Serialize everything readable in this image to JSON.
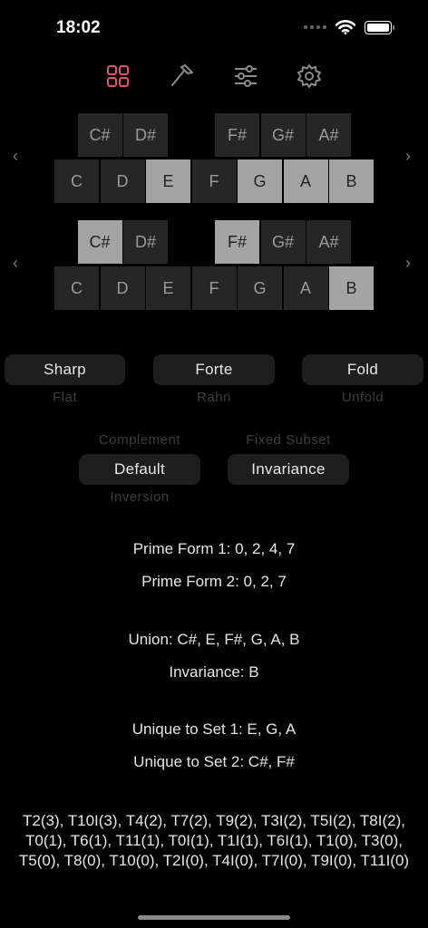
{
  "status": {
    "time": "18:02"
  },
  "toolbar": {
    "icons": [
      "grid-icon",
      "tuning-fork-icon",
      "sliders-icon",
      "gear-icon"
    ],
    "accent": "#d9536a",
    "icon_color": "#8a8a8a"
  },
  "keyboard1": {
    "black": [
      {
        "label": "C#",
        "on": false
      },
      {
        "label": "D#",
        "on": false
      },
      {
        "label": "F#",
        "on": false
      },
      {
        "label": "G#",
        "on": false
      },
      {
        "label": "A#",
        "on": false
      }
    ],
    "white": [
      {
        "label": "C",
        "on": false
      },
      {
        "label": "D",
        "on": false
      },
      {
        "label": "E",
        "on": true
      },
      {
        "label": "F",
        "on": false
      },
      {
        "label": "G",
        "on": true
      },
      {
        "label": "A",
        "on": true
      },
      {
        "label": "B",
        "on": true
      }
    ]
  },
  "keyboard2": {
    "black": [
      {
        "label": "C#",
        "on": true
      },
      {
        "label": "D#",
        "on": false
      },
      {
        "label": "F#",
        "on": true
      },
      {
        "label": "G#",
        "on": false
      },
      {
        "label": "A#",
        "on": false
      }
    ],
    "white": [
      {
        "label": "C",
        "on": false
      },
      {
        "label": "D",
        "on": false
      },
      {
        "label": "E",
        "on": false
      },
      {
        "label": "F",
        "on": false
      },
      {
        "label": "G",
        "on": false
      },
      {
        "label": "A",
        "on": false
      },
      {
        "label": "B",
        "on": true
      }
    ]
  },
  "nav": {
    "left": "‹",
    "right": "›"
  },
  "picker_row1": [
    {
      "selected": "Sharp",
      "below": "Flat"
    },
    {
      "selected": "Forte",
      "below": "Rahn"
    },
    {
      "selected": "Fold",
      "below": "Unfold"
    }
  ],
  "picker_row2": [
    {
      "above": "Complement",
      "selected": "Default",
      "below": "Inversion"
    },
    {
      "above": "Fixed Subset",
      "selected": "Invariance",
      "below": ""
    }
  ],
  "results": {
    "prime_form_1": "Prime Form 1: 0, 2, 4, 7",
    "prime_form_2": "Prime Form 2: 0, 2, 7",
    "union": "Union: C#, E, F#, G, A, B",
    "invariance": "Invariance: B",
    "unique_1": "Unique to Set 1: E, G, A",
    "unique_2": "Unique to Set 2: C#, F#",
    "transforms": "T2(3), T10I(3), T4(2), T7(2), T9(2), T3I(2), T5I(2), T8I(2), T0(1), T6(1), T11(1), T0I(1), T1I(1), T6I(1), T1(0), T3(0), T5(0), T8(0), T10(0), T2I(0), T4I(0), T7I(0), T9I(0), T11I(0)"
  }
}
